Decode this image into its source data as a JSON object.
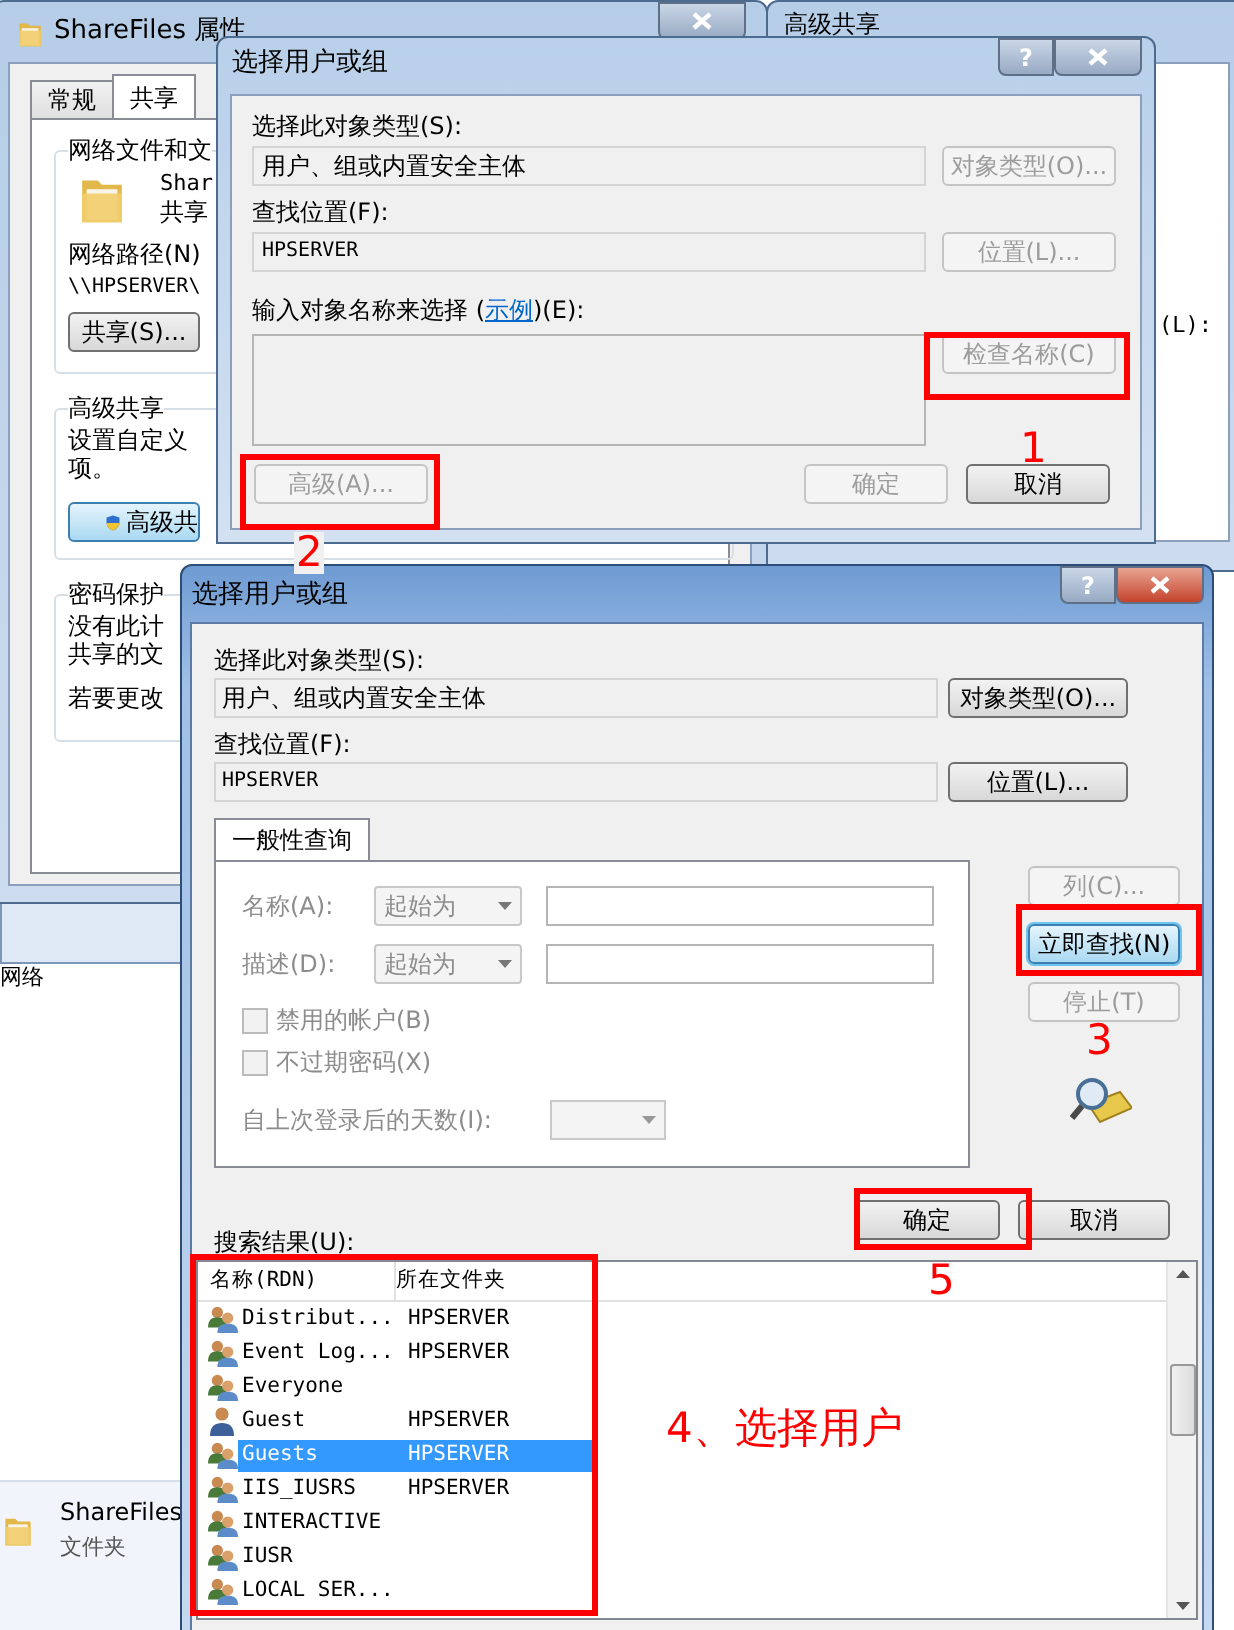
{
  "explorer": {
    "partial_label": "网络",
    "file_name": "ShareFiles",
    "file_type": "文件夹"
  },
  "properties_window": {
    "title": "ShareFiles 属性",
    "tabs": [
      {
        "label": "常规",
        "selected": false
      },
      {
        "label": "共享",
        "selected": true
      }
    ],
    "network_group": {
      "title": "网络文件和文",
      "name": "Shar",
      "status": "共享",
      "path_label": "网络路径(N)",
      "path": "\\\\HPSERVER\\",
      "share_button": "共享(S)..."
    },
    "advanced_group": {
      "title": "高级共享",
      "text": "设置自定义",
      "text_2": "项。",
      "button": "高级共"
    },
    "password_group": {
      "title": "密码保护",
      "lines": [
        "没有此计",
        "共享的文",
        "若要更改"
      ]
    }
  },
  "advanced_sharing_window": {
    "title": "高级共享",
    "label": "(L):"
  },
  "select_dialog_1": {
    "title": "选择用户或组",
    "help": "?",
    "object_type_label": "选择此对象类型(S):",
    "object_type": "用户、组或内置安全主体",
    "object_type_button": {
      "label": "对象类型(O)...",
      "disabled": true
    },
    "location_label": "查找位置(F):",
    "location": "HPSERVER",
    "location_button": {
      "label": "位置(L)...",
      "disabled": true
    },
    "names_label": "输入对象名称来选择 (",
    "example_link": "示例",
    "names_label_end": ")(E):",
    "check_names_button": {
      "label": "检查名称(C)",
      "disabled": true
    },
    "advanced_button": {
      "label": "高级(A)...",
      "disabled": true
    },
    "ok_button": {
      "label": "确定",
      "disabled": true
    },
    "cancel_button": {
      "label": "取消",
      "disabled": false
    }
  },
  "select_dialog_2": {
    "title": "选择用户或组",
    "help": "?",
    "object_type_label": "选择此对象类型(S):",
    "object_type": "用户、组或内置安全主体",
    "object_type_button": {
      "label": "对象类型(O)...",
      "disabled": false
    },
    "location_label": "查找位置(F):",
    "location": "HPSERVER",
    "location_button": {
      "label": "位置(L)...",
      "disabled": false
    },
    "query_tab": {
      "label": "一般性查询",
      "selected": true
    },
    "query_rows": [
      {
        "label": "名称(A):",
        "mode": "起始为",
        "disabled": true
      },
      {
        "label": "描述(D):",
        "mode": "起始为",
        "disabled": true
      }
    ],
    "checkboxes": [
      {
        "label": "禁用的帐户(B)",
        "checked": false,
        "disabled": true
      },
      {
        "label": "不过期密码(X)",
        "checked": false,
        "disabled": true
      }
    ],
    "days_label": "自上次登录后的天数(I):",
    "side_buttons": [
      {
        "label": "列(C)...",
        "disabled": true,
        "default": false
      },
      {
        "label": "立即查找(N)",
        "disabled": false,
        "default": true
      },
      {
        "label": "停止(T)",
        "disabled": true,
        "default": false
      }
    ],
    "ok_button": {
      "label": "确定",
      "disabled": false
    },
    "cancel_button": {
      "label": "取消",
      "disabled": false
    },
    "results_label": "搜索结果(U):",
    "results": {
      "columns": [
        "名称(RDN)",
        "所在文件夹"
      ],
      "rows": [
        {
          "name": "Distribut...",
          "folder": "HPSERVER",
          "kind": "group",
          "selected": false
        },
        {
          "name": "Event Log...",
          "folder": "HPSERVER",
          "kind": "group",
          "selected": false
        },
        {
          "name": "Everyone",
          "kind": "group",
          "selected": false
        },
        {
          "name": "Guest",
          "folder": "HPSERVER",
          "kind": "user",
          "selected": false
        },
        {
          "name": "Guests",
          "folder": "HPSERVER",
          "kind": "group",
          "selected": true
        },
        {
          "name": "IIS_IUSRS",
          "folder": "HPSERVER",
          "kind": "group",
          "selected": false
        },
        {
          "name": "INTERACTIVE",
          "kind": "group",
          "selected": false
        },
        {
          "name": "IUSR",
          "kind": "group",
          "selected": false
        },
        {
          "name": "LOCAL SER...",
          "kind": "group",
          "selected": false
        }
      ]
    }
  },
  "annotations": [
    {
      "text": "1"
    },
    {
      "text": "2"
    },
    {
      "text": "3"
    },
    {
      "text": "4、选择用户"
    },
    {
      "text": "5"
    }
  ]
}
